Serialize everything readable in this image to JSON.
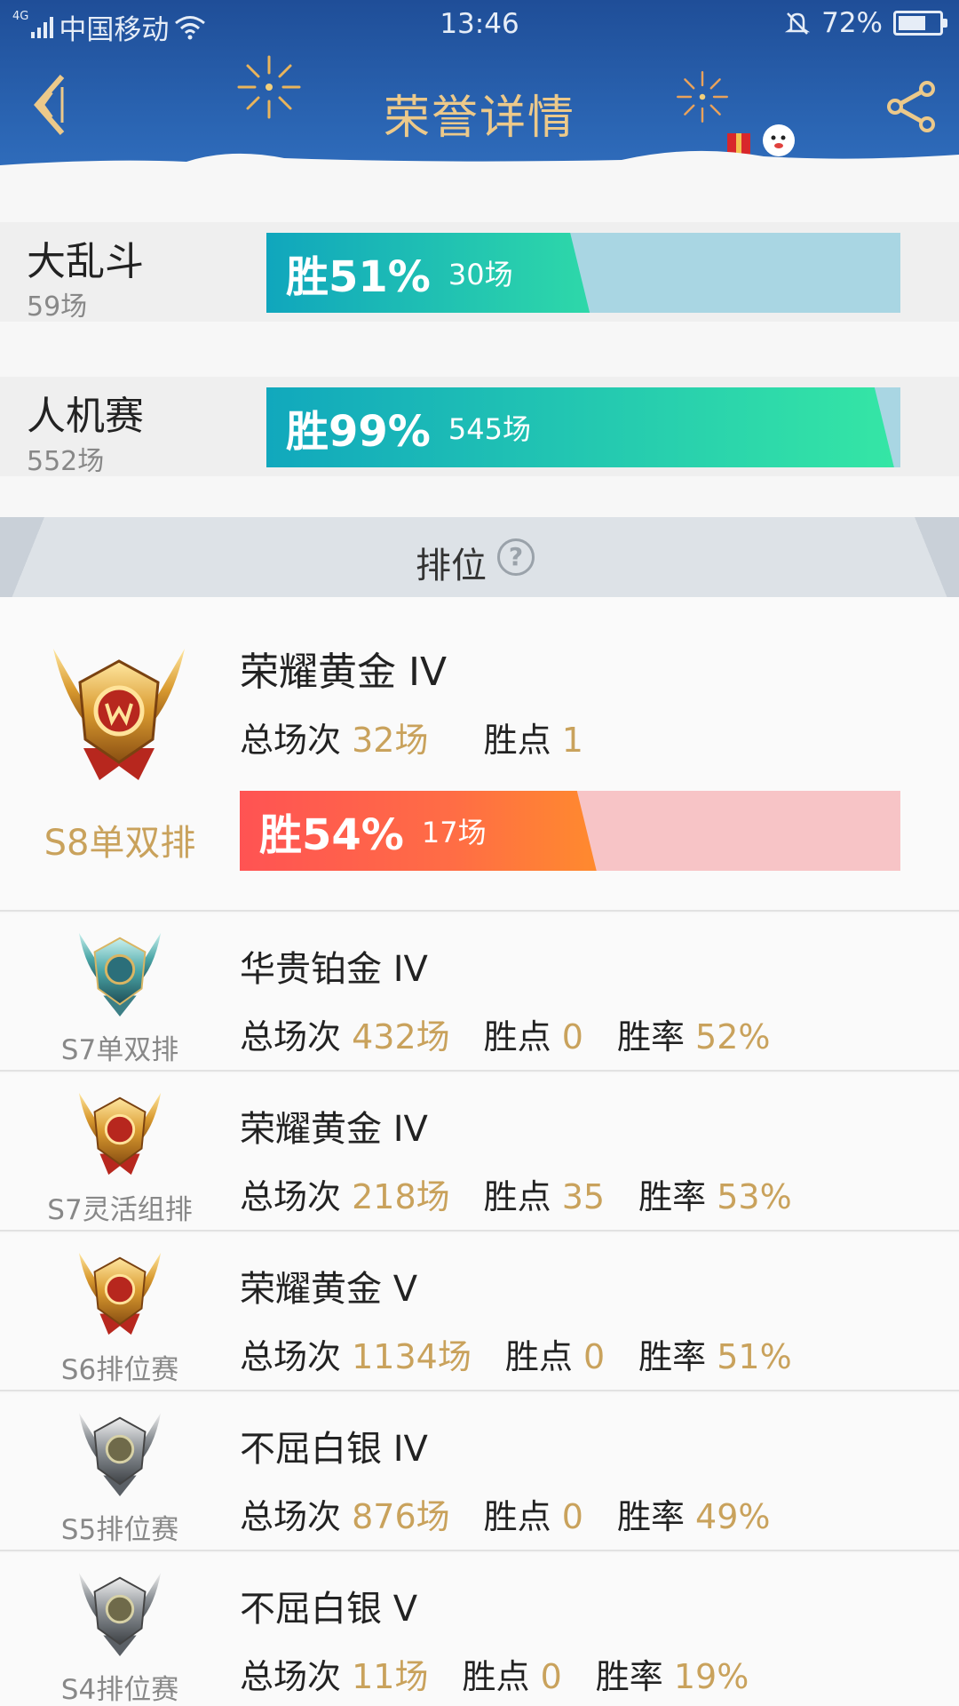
{
  "status_bar": {
    "network_type": "4G",
    "carrier": "中国移动",
    "time": "13:46",
    "battery": "72%",
    "battery_level": 0.72
  },
  "header": {
    "title": "荣誉详情",
    "title_color": "#ecc98a"
  },
  "modes": [
    {
      "name": "大乱斗",
      "count": "59场",
      "win_label": "胜51%",
      "wins": "30场",
      "win_rate": 0.51,
      "fill": "#10a6bd",
      "fill_end": "#2ed8a9"
    },
    {
      "name": "人机赛",
      "count": "552场",
      "win_label": "胜99%",
      "wins": "545场",
      "win_rate": 0.99,
      "fill": "#11a8bd",
      "fill_end": "#35e6a5"
    }
  ],
  "ranked": {
    "section_title": "排位",
    "help_icon": "?",
    "current": {
      "season": "S8单双排",
      "rank": "荣耀黄金 IV",
      "total_label": "总场次",
      "total": "32场",
      "points_label": "胜点",
      "points": "1",
      "win_label": "胜54%",
      "wins": "17场",
      "win_rate": 0.54
    },
    "stat_labels": {
      "total": "总场次",
      "points": "胜点",
      "rate": "胜率"
    },
    "history": [
      {
        "season": "S7单双排",
        "rank": "华贵铂金 IV",
        "total": "432场",
        "points": "0",
        "rate": "52%",
        "tier": "platinum"
      },
      {
        "season": "S7灵活组排",
        "rank": "荣耀黄金 IV",
        "total": "218场",
        "points": "35",
        "rate": "53%",
        "tier": "gold"
      },
      {
        "season": "S6排位赛",
        "rank": "荣耀黄金 V",
        "total": "1134场",
        "points": "0",
        "rate": "51%",
        "tier": "gold"
      },
      {
        "season": "S5排位赛",
        "rank": "不屈白银 IV",
        "total": "876场",
        "points": "0",
        "rate": "49%",
        "tier": "silver"
      },
      {
        "season": "S4排位赛",
        "rank": "不屈白银 V",
        "total": "11场",
        "points": "0",
        "rate": "19%",
        "tier": "silver"
      }
    ]
  },
  "colors": {
    "accent_gold": "#c9a25c",
    "loss_bar_pink": "#f7c4c6",
    "loss_bar_blue": "#a9d6e3"
  }
}
